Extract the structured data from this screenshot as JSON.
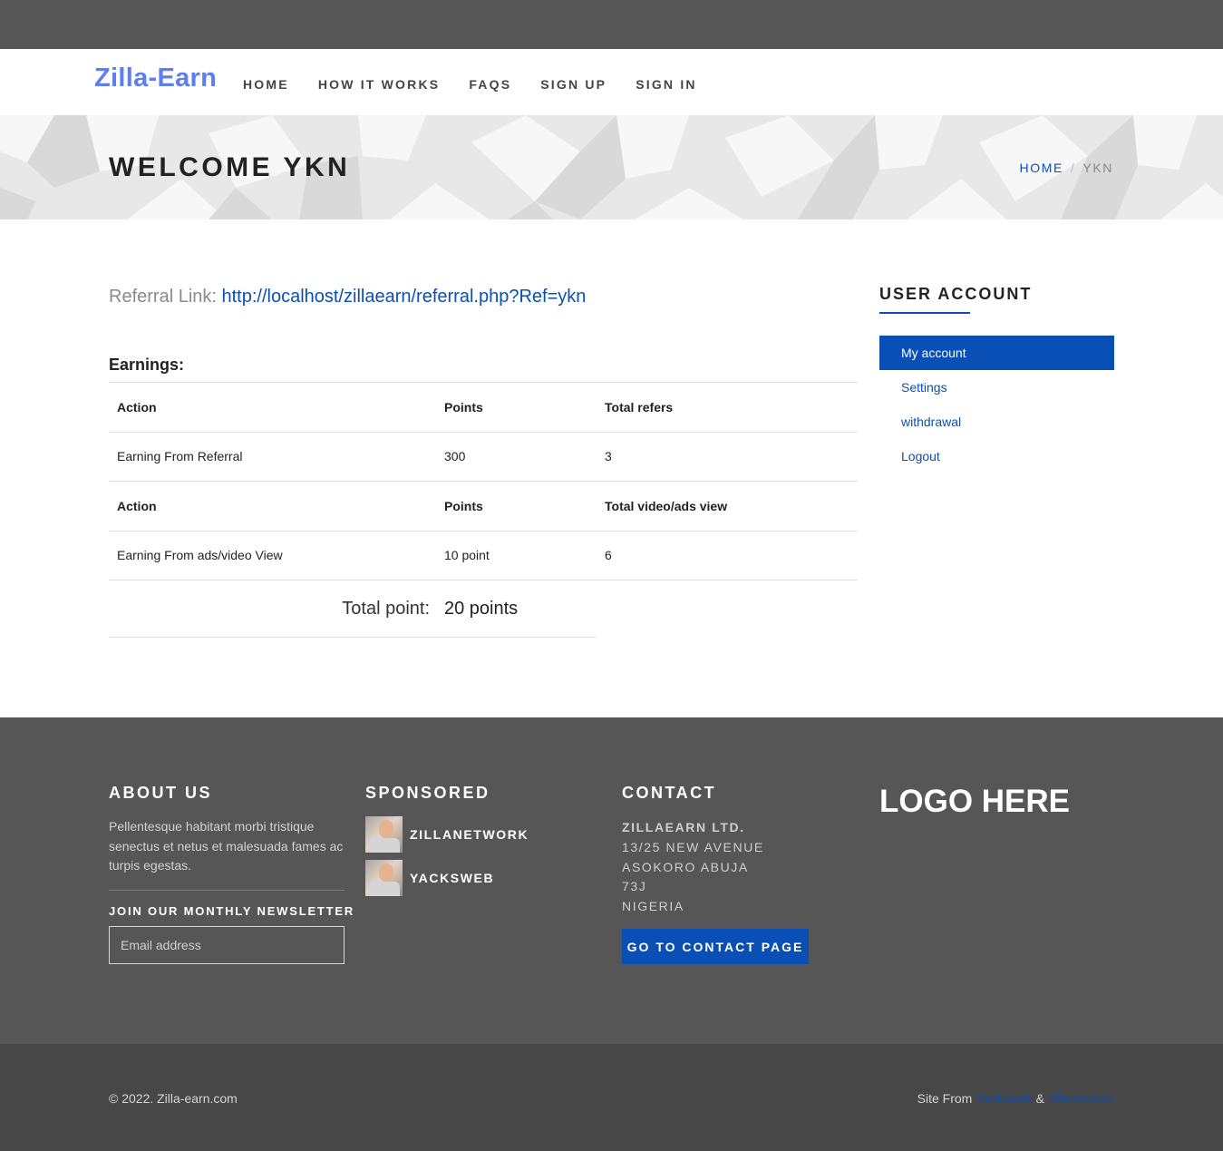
{
  "nav": {
    "brand": "Zilla-Earn",
    "items": [
      "HOME",
      "HOW IT WORKS",
      "FAQS",
      "SIGN UP",
      "SIGN IN"
    ]
  },
  "hero": {
    "title": "WELCOME YKN",
    "breadcrumb": {
      "home": "HOME",
      "separator": "/",
      "current": "YKN"
    }
  },
  "referral": {
    "label": "Referral Link:",
    "url": "http://localhost/zillaearn/referral.php?Ref=ykn"
  },
  "earnings": {
    "heading": "Earnings:",
    "rows": [
      {
        "type": "header",
        "cells": [
          "Action",
          "Points",
          "Total refers"
        ]
      },
      {
        "type": "data",
        "cells": [
          "Earning From Referral",
          "300",
          "3"
        ]
      },
      {
        "type": "header",
        "cells": [
          "Action",
          "Points",
          "Total video/ads view"
        ]
      },
      {
        "type": "data",
        "cells": [
          "Earning From ads/video View",
          "10 point",
          "6"
        ]
      }
    ],
    "total_label": "Total point:",
    "total_value": "20 points"
  },
  "sidebar": {
    "title": "USER ACCOUNT",
    "items": [
      {
        "label": "My account",
        "active": true
      },
      {
        "label": "Settings",
        "active": false
      },
      {
        "label": "withdrawal",
        "active": false
      },
      {
        "label": "Logout",
        "active": false
      }
    ]
  },
  "footer": {
    "about": {
      "heading": "ABOUT US",
      "text": "Pellentesque habitant morbi tristique senectus et netus et malesuada fames ac turpis egestas.",
      "newsletter_heading": "JOIN OUR MONTHLY NEWSLETTER",
      "email_placeholder": "Email address"
    },
    "sponsored": {
      "heading": "SPONSORED",
      "items": [
        "ZILLANETWORK",
        "YACKSWEB"
      ]
    },
    "contact": {
      "heading": "CONTACT",
      "company": "ZILLAEARN LTD.",
      "address": [
        "13/25 NEW AVENUE",
        "ASOKORO ABUJA",
        "73J",
        "NIGERIA"
      ],
      "button": "GO TO CONTACT PAGE"
    },
    "logo_text": "LOGO HERE"
  },
  "bottom": {
    "copyright": "© 2022. Zilla-earn.com",
    "credits_prefix": "Site From",
    "credit_1": "Yacksweb",
    "credits_joiner": "&",
    "credit_2": "zillanetwork"
  },
  "colors": {
    "accent": "#0a4fb5",
    "brand": "#5d7ef0",
    "footer_bg": "#565656",
    "bottom_bg": "#474747"
  }
}
